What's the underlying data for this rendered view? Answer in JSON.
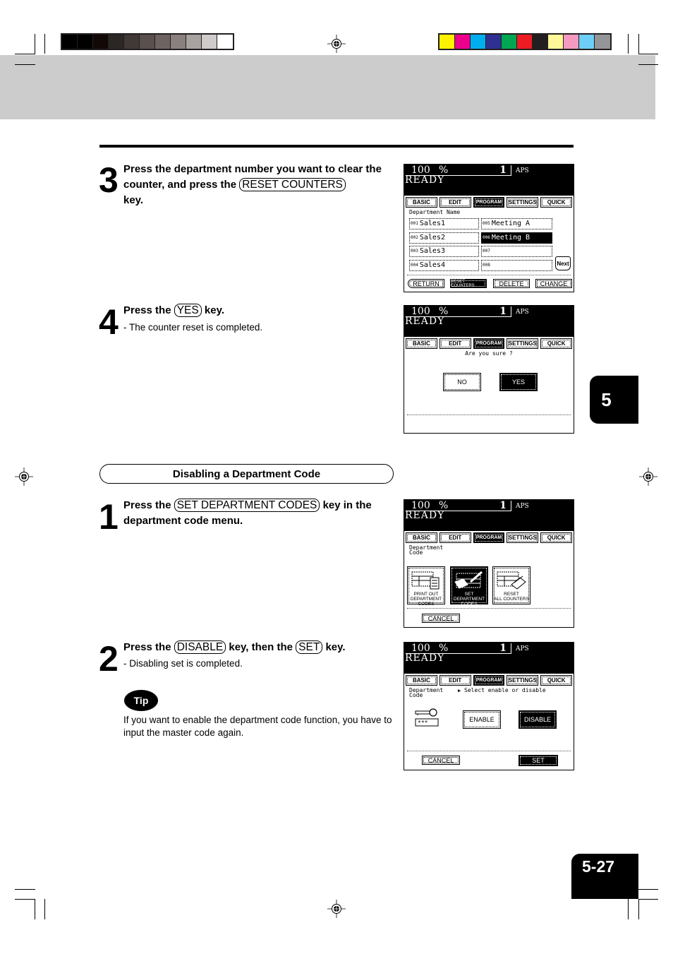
{
  "print_marks": {
    "grayscale_swatches": [
      "#000000",
      "#000000",
      "#120806",
      "#2b2724",
      "#403936",
      "#59504d",
      "#6d6461",
      "#8a817e",
      "#a8a2a0",
      "#cfcbcb",
      "#ffffff"
    ],
    "color_swatches": [
      "#fff200",
      "#ec008c",
      "#00aeef",
      "#2e3192",
      "#00a651",
      "#ed1c24",
      "#231f20",
      "#fff799",
      "#f49ac1",
      "#6dcff6",
      "#939598"
    ]
  },
  "steps_reset": [
    {
      "number": "3",
      "text_before": "Press the department number you want to clear the counter, and press the",
      "key": "RESET COUNTERS",
      "text_after": "key."
    },
    {
      "number": "4",
      "text_before": "Press the",
      "key": "YES",
      "text_after": "key.",
      "sub": "-  The counter reset is completed."
    }
  ],
  "section": {
    "title": "Disabling a Department Code"
  },
  "steps_disable": [
    {
      "number": "1",
      "text_before": "Press the",
      "key": "SET DEPARTMENT CODES",
      "text_after": "key in the department code menu."
    },
    {
      "number": "2",
      "text_before": "Press the",
      "key": "DISABLE",
      "text_middle": "key, then the",
      "key2": "SET",
      "text_after": "key.",
      "sub": "-  Disabling set is completed."
    }
  ],
  "tip": {
    "badge": "Tip",
    "text": "If you want to enable the department code function, you have to input the master code again."
  },
  "chapter_tab": "5",
  "page_number": "5-27",
  "lcd_common": {
    "ratio": "100",
    "pct": "%",
    "count": "1",
    "paper": "APS",
    "status": "READY",
    "tabs": [
      "BASIC",
      "EDIT",
      "PROGRAM",
      "SETTINGS",
      "QUICK"
    ],
    "active_tab": "PROGRAM"
  },
  "screen_dept_name": {
    "heading": "Department Name",
    "cells": [
      {
        "num": "001",
        "name": "Sales1"
      },
      {
        "num": "002",
        "name": "Sales2"
      },
      {
        "num": "003",
        "name": "Sales3"
      },
      {
        "num": "004",
        "name": "Sales4"
      },
      {
        "num": "005",
        "name": "Meeting A"
      },
      {
        "num": "006",
        "name": "Meeting B",
        "selected": true
      },
      {
        "num": "007",
        "name": ""
      },
      {
        "num": "008",
        "name": ""
      }
    ],
    "next_label": "Next",
    "buttons": [
      "RETURN",
      "RESET COUNTERS",
      "DELETE",
      "CHANGE"
    ]
  },
  "screen_confirm": {
    "question": "Are you sure ?",
    "no_label": "NO",
    "yes_label": "YES"
  },
  "screen_dept_menu": {
    "heading_line1": "Department",
    "heading_line2": "Code",
    "tiles": [
      {
        "line1": "PRINT OUT",
        "line2": "DEPARTMENT CODES"
      },
      {
        "line1": "SET",
        "line2": "DEPARTMENT CODES",
        "selected": true
      },
      {
        "line1": "RESET",
        "line2": "ALL COUNTERS"
      }
    ],
    "cancel_label": "CANCEL"
  },
  "screen_enable_disable": {
    "heading_line1": "Department",
    "heading_line2": "Code",
    "prompt": "Select enable or disable",
    "masked_code": "***_",
    "enable_label": "ENABLE",
    "disable_label": "DISABLE",
    "cancel_label": "CANCEL",
    "set_label": "SET"
  }
}
